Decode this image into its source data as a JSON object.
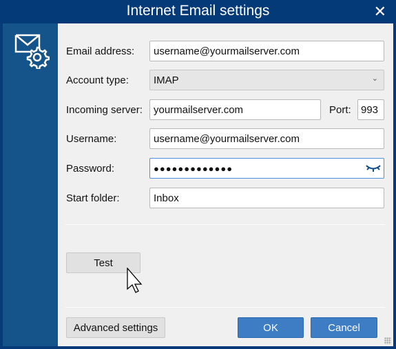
{
  "window": {
    "title": "Internet Email settings",
    "close_icon": "close-icon"
  },
  "sidebar": {
    "icon": "mail-settings-icon"
  },
  "form": {
    "email_label": "Email address:",
    "email_value": "username@yourmailserver.com",
    "account_type_label": "Account type:",
    "account_type_value": "IMAP",
    "incoming_label": "Incoming server:",
    "incoming_value": "yourmailserver.com",
    "port_label": "Port:",
    "port_value": "993",
    "username_label": "Username:",
    "username_value": "username@yourmailserver.com",
    "password_label": "Password:",
    "password_value": "●●●●●●●●●●●●●",
    "start_folder_label": "Start folder:",
    "start_folder_value": "Inbox"
  },
  "buttons": {
    "test": "Test",
    "advanced": "Advanced settings",
    "ok": "OK",
    "cancel": "Cancel"
  },
  "colors": {
    "titlebar": "#043a78",
    "sidebar": "#14548a",
    "primary_button": "#3e7dc4"
  }
}
